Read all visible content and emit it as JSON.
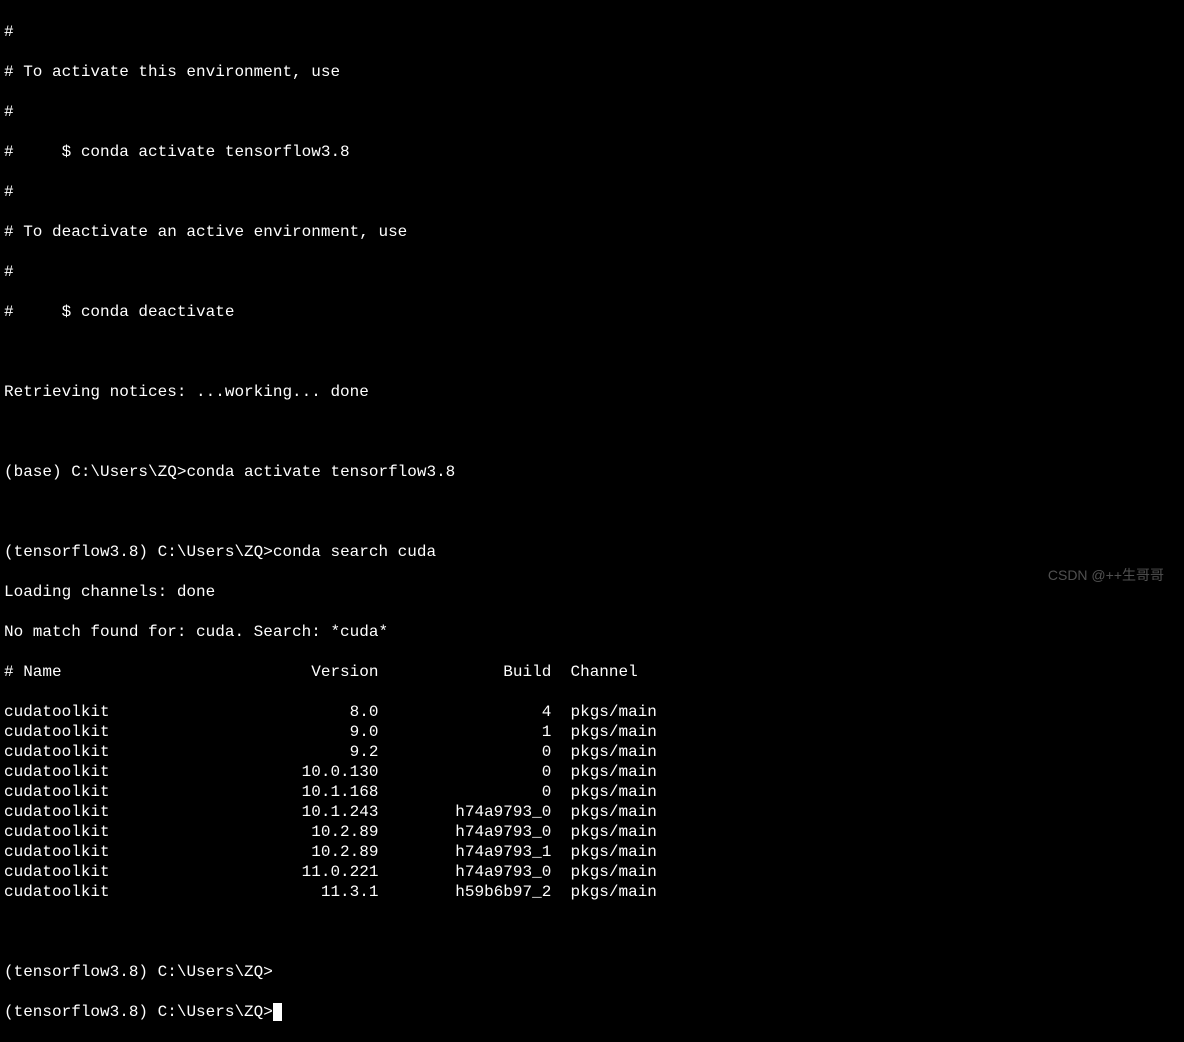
{
  "header": {
    "lines": [
      "#",
      "# To activate this environment, use",
      "#",
      "#     $ conda activate tensorflow3.8",
      "#",
      "# To deactivate an active environment, use",
      "#",
      "#     $ conda deactivate"
    ]
  },
  "retrieving": "Retrieving notices: ...working... done",
  "prompt1": {
    "env": "(base)",
    "path": "C:\\Users\\ZQ>",
    "command": "conda activate tensorflow3.8"
  },
  "prompt2": {
    "env": "(tensorflow3.8)",
    "path": "C:\\Users\\ZQ>",
    "command": "conda search cuda"
  },
  "loading": "Loading channels: done",
  "nomatch": "No match found for: cuda. Search: *cuda*",
  "table": {
    "header": {
      "name": "# Name",
      "version": "Version",
      "build": "Build",
      "channel": "Channel"
    },
    "rows": [
      {
        "name": "cudatoolkit",
        "version": "8.0",
        "build": "4",
        "channel": "pkgs/main"
      },
      {
        "name": "cudatoolkit",
        "version": "9.0",
        "build": "1",
        "channel": "pkgs/main"
      },
      {
        "name": "cudatoolkit",
        "version": "9.2",
        "build": "0",
        "channel": "pkgs/main"
      },
      {
        "name": "cudatoolkit",
        "version": "10.0.130",
        "build": "0",
        "channel": "pkgs/main"
      },
      {
        "name": "cudatoolkit",
        "version": "10.1.168",
        "build": "0",
        "channel": "pkgs/main"
      },
      {
        "name": "cudatoolkit",
        "version": "10.1.243",
        "build": "h74a9793_0",
        "channel": "pkgs/main"
      },
      {
        "name": "cudatoolkit",
        "version": "10.2.89",
        "build": "h74a9793_0",
        "channel": "pkgs/main"
      },
      {
        "name": "cudatoolkit",
        "version": "10.2.89",
        "build": "h74a9793_1",
        "channel": "pkgs/main"
      },
      {
        "name": "cudatoolkit",
        "version": "11.0.221",
        "build": "h74a9793_0",
        "channel": "pkgs/main"
      },
      {
        "name": "cudatoolkit",
        "version": "11.3.1",
        "build": "h59b6b97_2",
        "channel": "pkgs/main"
      }
    ]
  },
  "prompt3": {
    "env": "(tensorflow3.8)",
    "path": "C:\\Users\\ZQ>",
    "command": ""
  },
  "prompt4": {
    "env": "(tensorflow3.8)",
    "path": "C:\\Users\\ZQ>",
    "command": ""
  },
  "watermark": "CSDN @++生哥哥"
}
